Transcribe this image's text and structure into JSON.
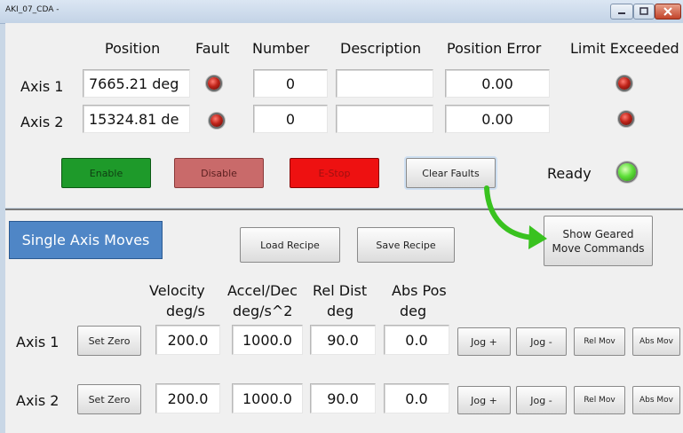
{
  "window": {
    "title": "AKI_07_CDA -"
  },
  "headers": {
    "position": "Position",
    "fault": "Fault",
    "number": "Number",
    "description": "Description",
    "position_error": "Position Error",
    "limit_exceeded": "Limit Exceeded"
  },
  "axes": [
    {
      "label": "Axis 1",
      "position": "7665.21 deg",
      "number": "0",
      "description": "",
      "position_error": "0.00"
    },
    {
      "label": "Axis 2",
      "position": "15324.81 de",
      "number": "0",
      "description": "",
      "position_error": "0.00"
    }
  ],
  "controls": {
    "enable": "Enable",
    "disable": "Disable",
    "estop": "E-Stop",
    "clear_faults": "Clear Faults",
    "ready_label": "Ready"
  },
  "colors": {
    "enable": "#1e9a2a",
    "disable": "#c96a6a",
    "estop": "#ee1111",
    "ready_led": "#5fe03a",
    "fault_led": "#b0201a",
    "arrow": "#39c21f",
    "single_axis_bg": "#4f86c6"
  },
  "moves": {
    "section_label": "Single Axis Moves",
    "load_recipe": "Load Recipe",
    "save_recipe": "Save Recipe",
    "show_geared_line1": "Show Geared",
    "show_geared_line2": "Move Commands",
    "headers": {
      "velocity": "Velocity",
      "velocity_unit": "deg/s",
      "accel": "Accel/Dec",
      "accel_unit": "deg/s^2",
      "rel_dist": "Rel Dist",
      "rel_dist_unit": "deg",
      "abs_pos": "Abs Pos",
      "abs_pos_unit": "deg"
    },
    "axes": [
      {
        "label": "Axis 1",
        "set_zero": "Set Zero",
        "velocity": "200.0",
        "accel": "1000.0",
        "rel_dist": "90.0",
        "abs_pos": "0.0",
        "jog_plus": "Jog +",
        "jog_minus": "Jog -",
        "rel_mov": "Rel Mov",
        "abs_mov": "Abs Mov"
      },
      {
        "label": "Axis 2",
        "set_zero": "Set Zero",
        "velocity": "200.0",
        "accel": "1000.0",
        "rel_dist": "90.0",
        "abs_pos": "0.0",
        "jog_plus": "Jog +",
        "jog_minus": "Jog -",
        "rel_mov": "Rel Mov",
        "abs_mov": "Abs Mov"
      }
    ]
  }
}
